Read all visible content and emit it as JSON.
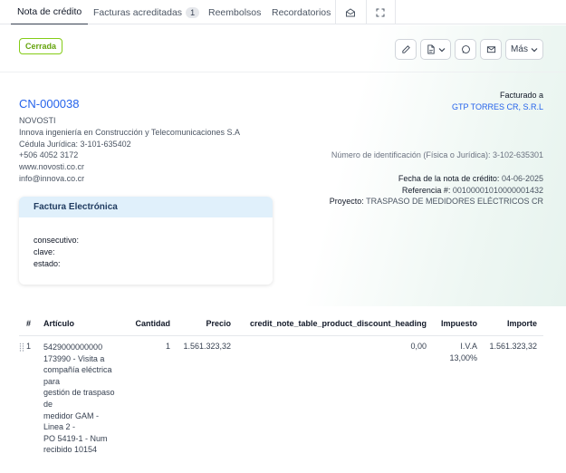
{
  "tabs": [
    {
      "label": "Nota de crédito"
    },
    {
      "label": "Facturas acreditadas",
      "badge": "1"
    },
    {
      "label": "Reembolsos"
    },
    {
      "label": "Recordatorios"
    }
  ],
  "status": {
    "label": "Cerrada"
  },
  "toolbar": {
    "more_label": "Más"
  },
  "document": {
    "number": "CN-000038",
    "company": [
      "NOVOSTI",
      "Innova ingeniería en Construcción y Telecomunicaciones S.A",
      "Cédula Jurídica: 3-101-635402",
      "+506 4052 3172",
      "www.novosti.co.cr",
      "info@innova.co.cr"
    ],
    "bill_to": {
      "label": "Facturado a",
      "name": "GTP TORRES CR, S.R.L",
      "id_number": "Número de identificación (Física o Jurídica): 3-102-635301"
    },
    "meta": {
      "date_label": "Fecha de la nota de crédito:",
      "date_value": "04-06-2025",
      "ref_label": "Referencia #:",
      "ref_value": "00100001010000001432",
      "project_label": "Proyecto:",
      "project_value": "TRASPASO DE MEDIDORES ELÉCTRICOS CR"
    }
  },
  "e_invoice": {
    "title": "Factura Electrónica",
    "consecutivo": "consecutivo:",
    "clave": "clave:",
    "estado": "estado:"
  },
  "table": {
    "headers": {
      "num": "#",
      "item": "Artículo",
      "qty": "Cantidad",
      "price": "Precio",
      "discount": "credit_note_table_product_discount_heading",
      "tax": "Impuesto",
      "amount": "Importe"
    },
    "rows": [
      {
        "num": "1",
        "code": "5429000000000",
        "description": [
          "173990 - Visita a",
          "compañía eléctrica",
          "para",
          "gestión de traspaso",
          "de",
          "medidor GAM -",
          "Linea 2 -",
          "PO 5419-1 - Num",
          "recibido 10154"
        ],
        "qty": "1",
        "price": "1.561.323,32",
        "discount": "0,00",
        "tax_name": "I.V.A",
        "tax_rate": "13,00%",
        "amount": "1.561.323,32"
      }
    ]
  }
}
